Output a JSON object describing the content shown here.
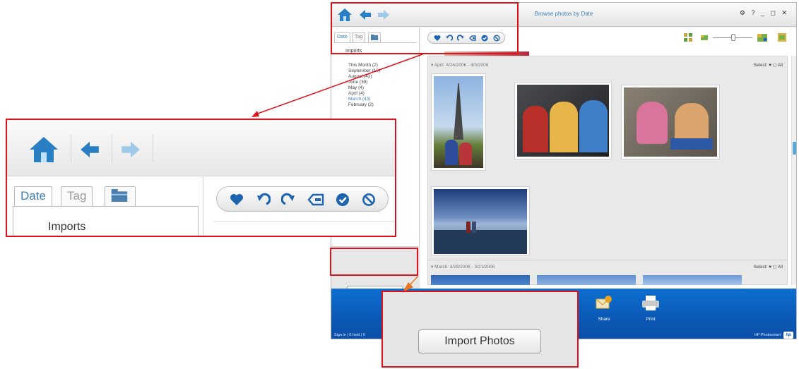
{
  "app": {
    "title": "Browse photos by Date",
    "window_controls": "⚙ ? _ ◻ ✕",
    "sidebar": {
      "tabs": [
        "Date",
        "Tag"
      ],
      "imports_label": "Imports",
      "months": [
        {
          "label": "This Month (2)"
        },
        {
          "label": "September (19)"
        },
        {
          "label": "August (42)"
        },
        {
          "label": "June (39)"
        },
        {
          "label": "May (4)"
        },
        {
          "label": "April (4)"
        },
        {
          "label": "March (43)"
        },
        {
          "label": "February (2)"
        }
      ],
      "import_button": "Import Photos"
    },
    "groups": [
      {
        "header": "April: 4/24/2006 - 4/3/2006",
        "select": "Select: ♥ ◻ All"
      },
      {
        "header": "March: 3/28/2006 - 3/21/2006",
        "select": "Select: ♥ ◻ All"
      }
    ],
    "taskbar": {
      "share_label": "Share",
      "print_label": "Print",
      "status_left": "Sign in | 0 held | 0",
      "status_right": "HP Photosmart",
      "logo": "hp"
    }
  },
  "zoom_toolbar": {
    "tabs": [
      "Date",
      "Tag"
    ],
    "imports_label": "Imports"
  },
  "zoom_import": {
    "button_label": "Import Photos"
  },
  "colors": {
    "highlight": "#e0111b",
    "accent": "#3d7fb3",
    "taskbar": "#0b58b4",
    "connector_orange": "#e8751a"
  }
}
